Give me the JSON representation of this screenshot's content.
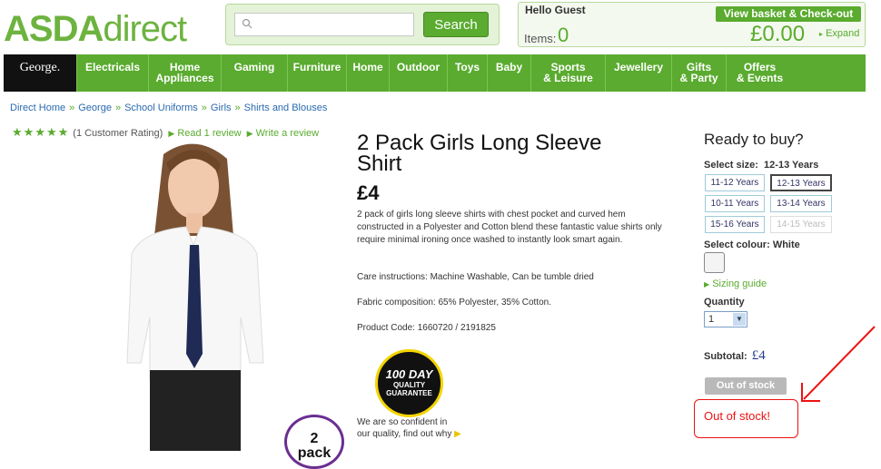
{
  "header": {
    "logo_bold": "ASDA",
    "logo_light": "direct",
    "search_button": "Search",
    "search_placeholder": "",
    "greeting": "Hello Guest",
    "items_label": "Items:",
    "items_count": "0",
    "view_basket": "View basket & Check-out",
    "basket_total": "£0.00",
    "expand": "Expand"
  },
  "nav": {
    "george": "George.",
    "items": [
      "Electricals",
      "Home Appliances",
      "Gaming",
      "Furniture",
      "Home",
      "Outdoor",
      "Toys",
      "Baby",
      "Sports & Leisure",
      "Jewellery",
      "Gifts & Party",
      "Offers & Events"
    ]
  },
  "breadcrumb": [
    "Direct Home",
    "George",
    "School Uniforms",
    "Girls",
    "Shirts and Blouses"
  ],
  "rating": {
    "stars": 5,
    "count_text": "(1 Customer Rating)",
    "read_review": "Read 1 review",
    "write_review": "Write a review"
  },
  "product": {
    "title": "2 Pack Girls Long Sleeve Shirt",
    "price": "£4",
    "description": "2 pack of girls long sleeve shirts with chest pocket and curved hem constructed in a Polyester and Cotton blend these fantastic value shirts only require minimal ironing once washed to instantly look smart again.",
    "care": "Care instructions: Machine Washable, Can be tumble dried",
    "fabric": "Fabric composition: 65% Polyester, 35% Cotton.",
    "code": "Product Code: 1660720 / 2191825",
    "pack_badge_l1": "2",
    "pack_badge_l2": "pack"
  },
  "guarantee": {
    "line1": "100 DAY",
    "line2": "QUALITY",
    "line3": "GUARANTEE",
    "text1": "We are so confident in",
    "text2": "our quality, find out why"
  },
  "buy": {
    "ready": "Ready to buy?",
    "select_size_label": "Select size:",
    "selected_size": "12-13 Years",
    "sizes": [
      "11-12 Years",
      "12-13 Years",
      "10-11 Years",
      "13-14 Years",
      "15-16 Years",
      "14-15 Years"
    ],
    "select_colour_label": "Select colour:",
    "selected_colour": "White",
    "sizing_guide": "Sizing guide",
    "quantity_label": "Quantity",
    "quantity": "1",
    "subtotal_label": "Subtotal:",
    "subtotal": "£4",
    "out_of_stock_button": "Out of stock",
    "annotation": "Out of stock!"
  }
}
